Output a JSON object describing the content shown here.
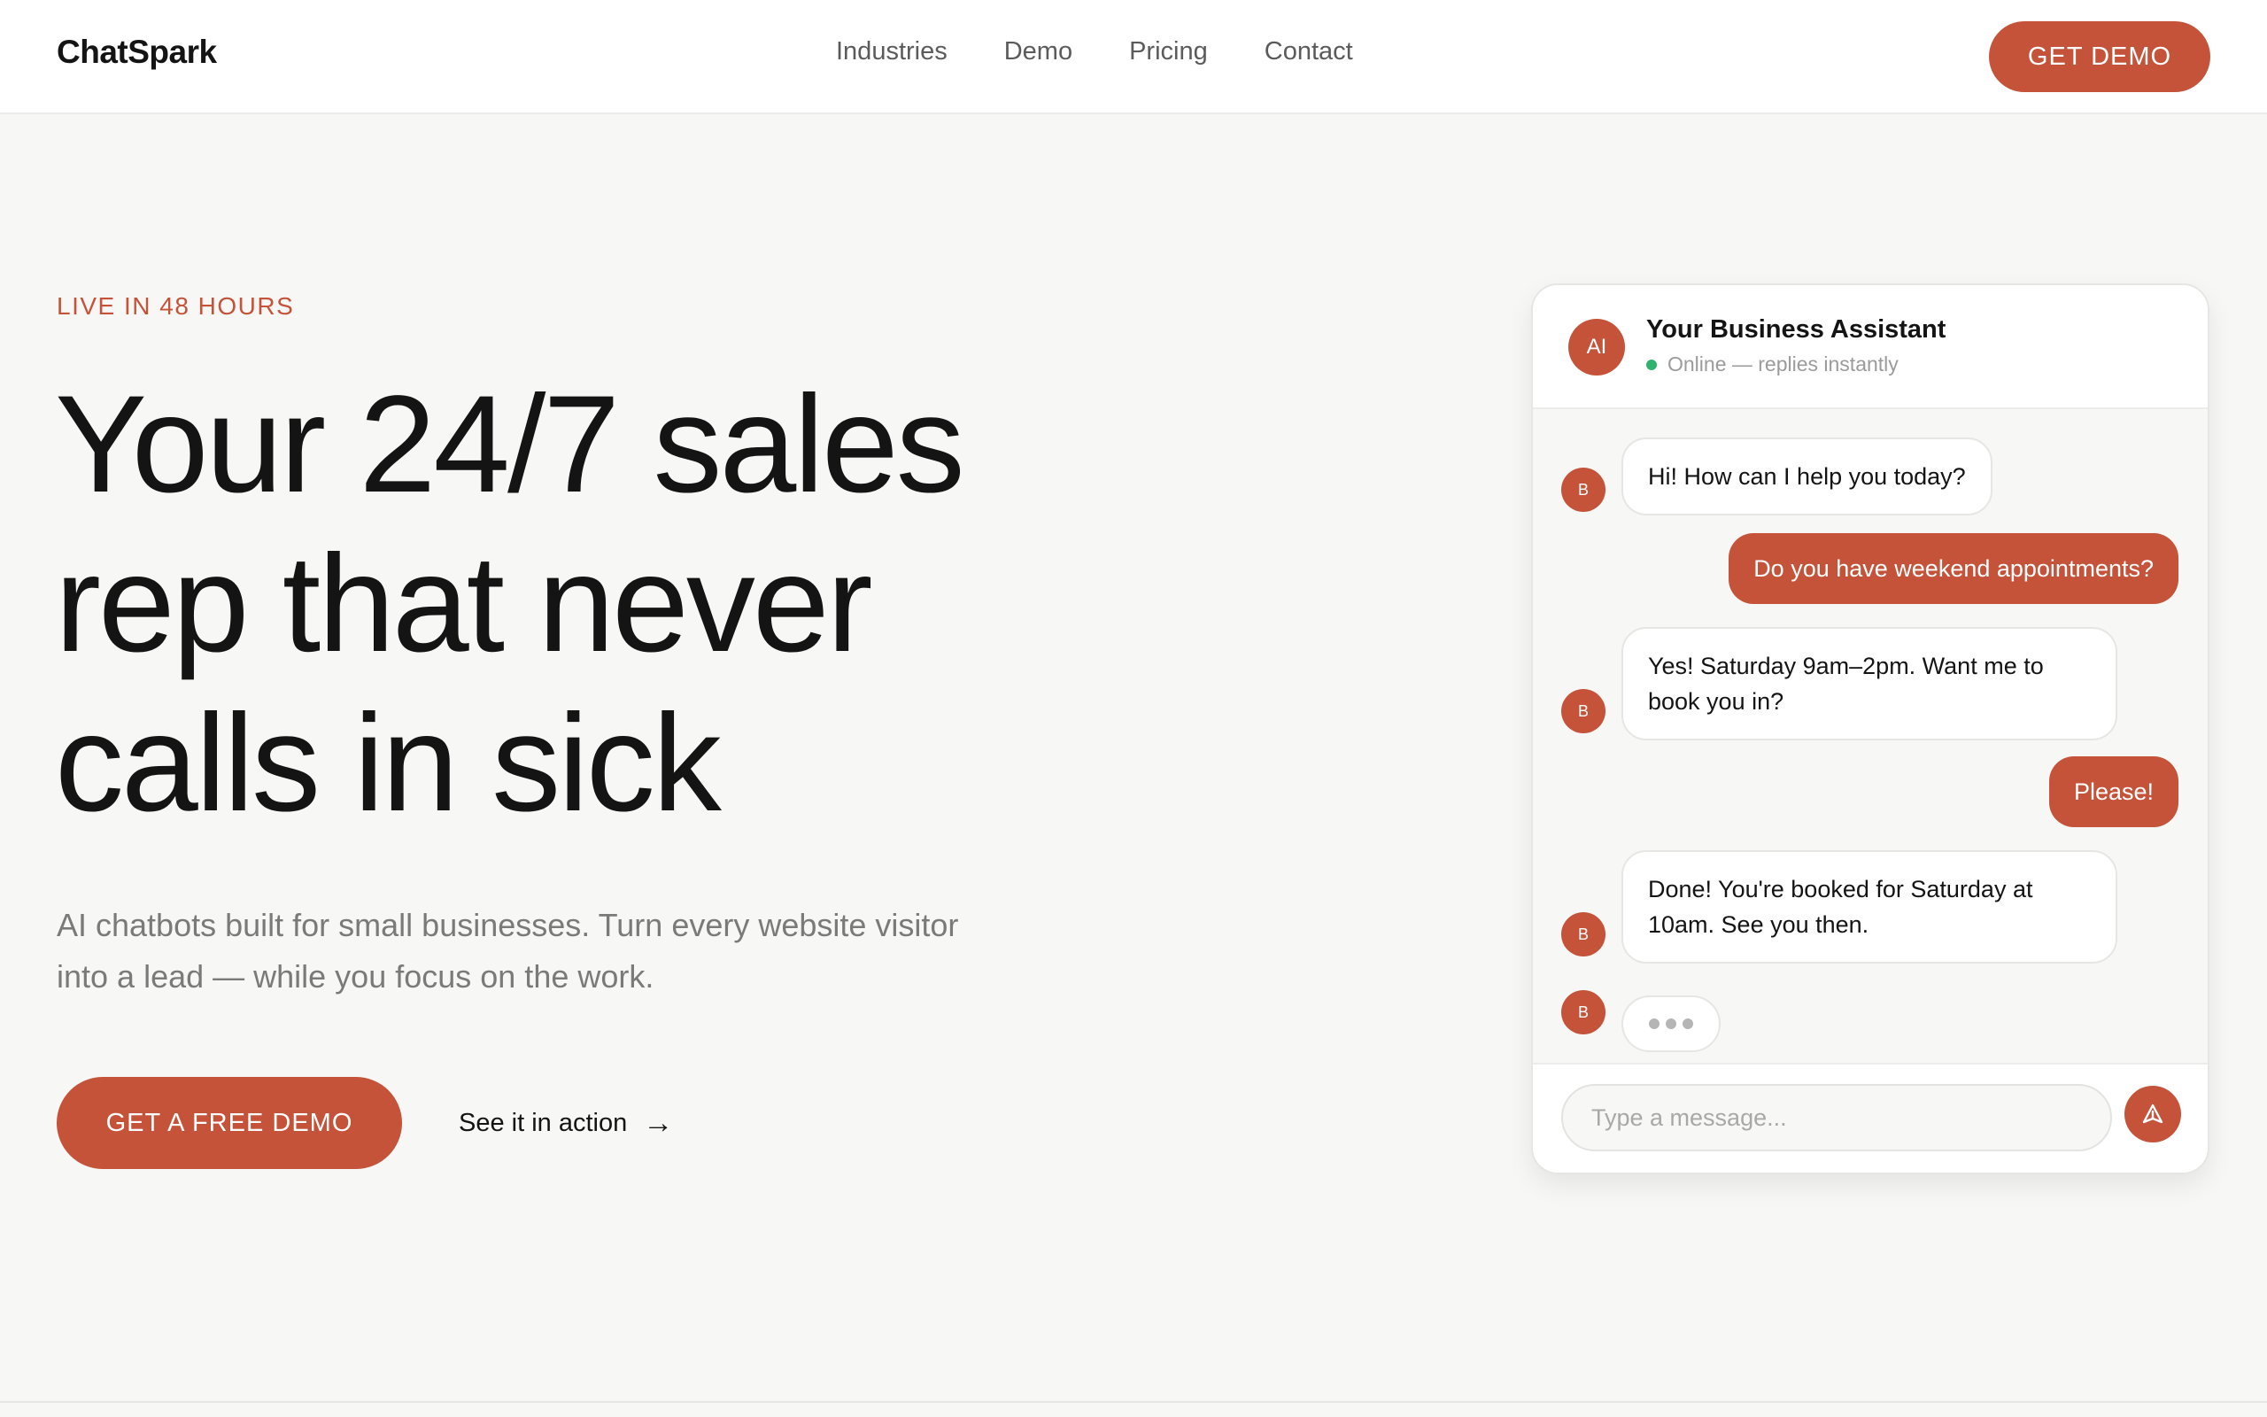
{
  "header": {
    "logo": "ChatSpark",
    "nav": [
      "Industries",
      "Demo",
      "Pricing",
      "Contact"
    ],
    "cta": "GET DEMO"
  },
  "hero": {
    "eyebrow": "LIVE IN 48 HOURS",
    "headline_lines": [
      "Your 24/7 sales",
      "rep that never",
      "calls in sick"
    ],
    "subhead": "AI chatbots built for small businesses. Turn every website visitor into a lead — while you focus on the work.",
    "primary_cta": "GET A FREE DEMO",
    "secondary_cta": "See it in action",
    "secondary_cta_icon": "→"
  },
  "chat": {
    "avatar": "AI",
    "title": "Your Business Assistant",
    "status": "Online — replies instantly",
    "bot_avatar": "B",
    "messages": [
      {
        "from": "bot",
        "text": "Hi! How can I help you today?"
      },
      {
        "from": "user",
        "text": "Do you have weekend appointments?"
      },
      {
        "from": "bot",
        "text": "Yes! Saturday 9am–2pm. Want me to book you in?"
      },
      {
        "from": "user",
        "text": "Please!"
      },
      {
        "from": "bot",
        "text": "Done! You're booked for Saturday at 10am. See you then."
      }
    ],
    "input_placeholder": "Type a message..."
  },
  "colors": {
    "accent": "#c4533a",
    "background": "#f7f7f5",
    "online": "#2fb36c"
  },
  "icons": [
    "arrow-right-icon",
    "send-icon",
    "typing-indicator-icon",
    "online-dot-icon"
  ]
}
